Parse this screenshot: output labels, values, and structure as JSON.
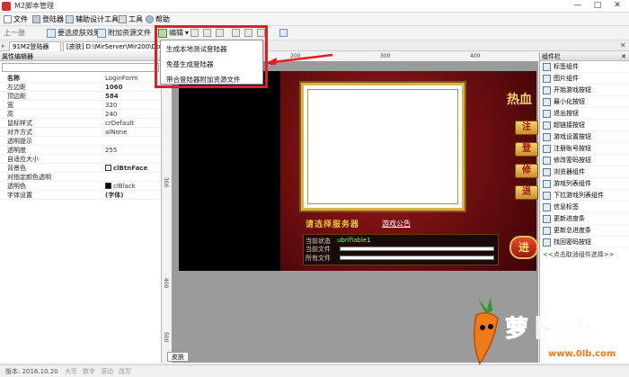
{
  "window": {
    "title": "M2脚本管理",
    "controls": [
      "—",
      "□",
      "✕"
    ]
  },
  "menu": {
    "items": [
      "文件",
      "登陆器",
      "辅助设计工具",
      "工具",
      "帮助"
    ]
  },
  "toolbar": {
    "nav_label": "上一张",
    "btn_effect": "要选皮肤效果",
    "btn_attach": "附加资源文件",
    "btn_edit": "编辑"
  },
  "dropdown": {
    "items": [
      "生成本地测试登陆器",
      "免基生成登陆器",
      "带合登陆器附加资源文件"
    ]
  },
  "tabs": {
    "tab1": "91M2登陆器",
    "tab2": "[皮肤] D:\\MirServer\\Mir200\\Dow"
  },
  "props": {
    "header": "属性编辑器",
    "rows": [
      {
        "k": "名称",
        "v": "LoginForm"
      },
      {
        "k": "左边距",
        "v": "1060"
      },
      {
        "k": "顶边距",
        "v": "584"
      },
      {
        "k": "宽",
        "v": "320"
      },
      {
        "k": "高",
        "v": "240"
      },
      {
        "k": "鼠标样式",
        "v": "crDefault"
      },
      {
        "k": "对齐方式",
        "v": "alNone"
      },
      {
        "k": "透明提示",
        "v": ""
      },
      {
        "k": "透明度",
        "v": "255"
      },
      {
        "k": "自适应大小",
        "v": ""
      },
      {
        "k": "背景色",
        "v": "clBtnFace"
      },
      {
        "k": "对指定颜色透明",
        "v": ""
      },
      {
        "k": "透明色",
        "v": "clBlack"
      },
      {
        "k": "字体设置",
        "v": "(字体)"
      }
    ]
  },
  "ruler": {
    "h": [
      "200",
      "300",
      "400"
    ],
    "v": [
      "300",
      "400",
      "500"
    ]
  },
  "canvas": {
    "game_title": "热血",
    "server_label": "请选择服务器",
    "server_link": "游戏公告",
    "status_current": "当前状态",
    "status_value": "ubrifiable1",
    "current_file": "当前文件",
    "all_files": "所有文件",
    "start_btn": "进",
    "side_buttons": [
      "注",
      "登",
      "修",
      "退"
    ]
  },
  "components": {
    "header": "组件栏",
    "items": [
      "标签组件",
      "图片组件",
      "开始游戏按钮",
      "最小化按钮",
      "退出按钮",
      "超链接按钮",
      "游戏设置按钮",
      "注册账号按钮",
      "修改密码按钮",
      "浏览器组件",
      "游戏列表组件",
      "下拉游戏列表组件",
      "信息标签",
      "更新进度条",
      "更新总进度条",
      "找回密码按钮"
    ],
    "footer": "<<点击取消组件选择>>"
  },
  "bottom_tab": "皮肤",
  "status": {
    "version": "版本: 2016.10.20",
    "caps": "大写",
    "num": "数字",
    "scroll": "滚动",
    "ins": "改写"
  },
  "logo": {
    "brand": "萝卜论坛",
    "url": "www.0lb.com"
  },
  "colors": {
    "highlight": "#e02020",
    "game_red": "#8a1215",
    "gold": "#d9b44a"
  }
}
